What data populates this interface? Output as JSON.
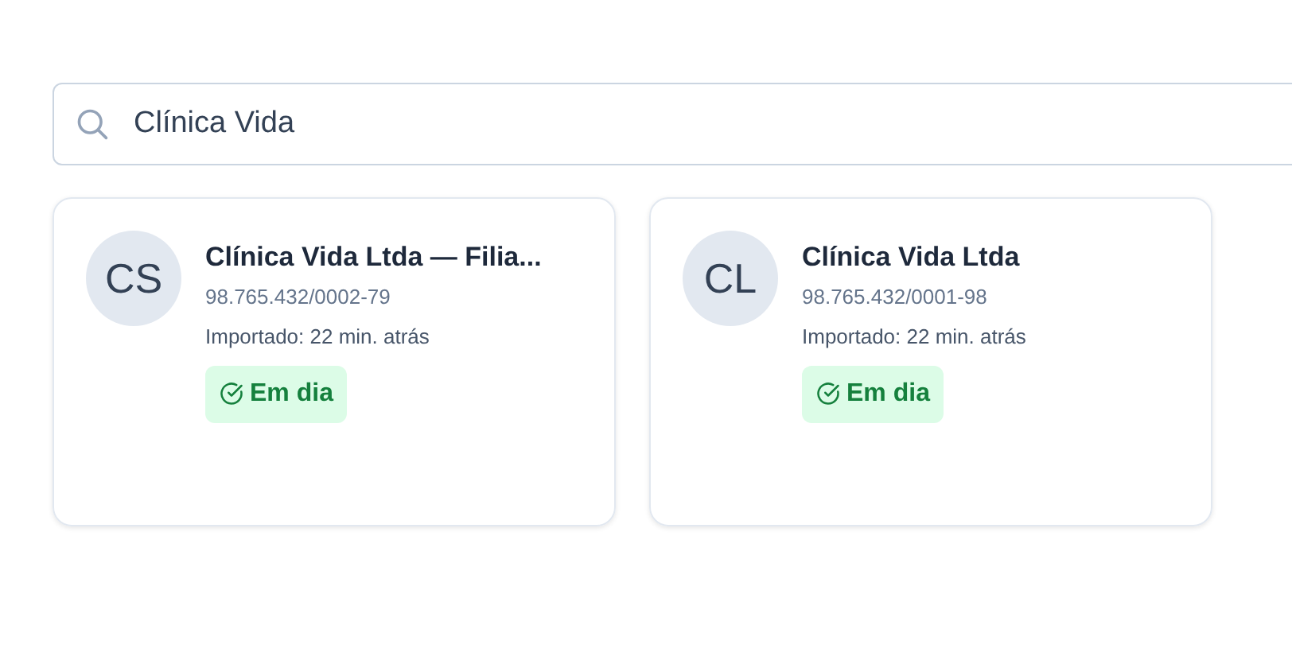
{
  "search": {
    "value": "Clínica Vida"
  },
  "cards": [
    {
      "initials": "CS",
      "name": "Clínica Vida Ltda — Filia...",
      "cnpj": "98.765.432/0002-79",
      "imported": "Importado: 22 min. atrás",
      "status": {
        "kind": "ok",
        "label": "Em dia"
      }
    },
    {
      "initials": "CL",
      "name": "Clínica Vida Ltda",
      "cnpj": "98.765.432/0001-98",
      "imported": "Importado: 22 min. atrás",
      "status": {
        "kind": "ok",
        "label": "Em dia"
      }
    }
  ]
}
